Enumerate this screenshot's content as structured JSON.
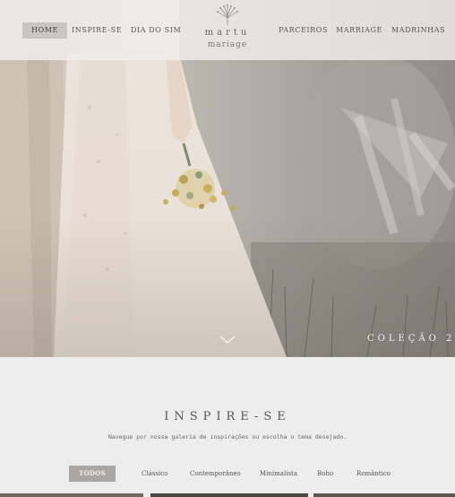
{
  "nav": {
    "left_items": [
      {
        "label": "HOME",
        "active": true
      },
      {
        "label": "INSPIRE-SE",
        "active": false
      },
      {
        "label": "DIA DO SIM",
        "active": false
      }
    ],
    "right_items": [
      {
        "label": "PARCEIROS"
      },
      {
        "label": "MARRIAGE"
      },
      {
        "label": "MADRINHAS"
      }
    ],
    "logo": {
      "name": "martu",
      "subtitle": "mariage",
      "icon": "flower-bouquet-logo-icon"
    }
  },
  "hero": {
    "collection_label": "COLEÇÃO 2",
    "scroll_icon": "chevron-down-icon"
  },
  "inspire": {
    "title": "INSPIRE-SE",
    "subtitle": "Navegue por nossa galeria de inspirações ou escolha o tema desejado.",
    "filters": [
      "TODOS",
      "Clássico",
      "Contemporâneo",
      "Minimalista",
      "Boho",
      "Romântico"
    ],
    "active_filter": "TODOS"
  },
  "colors": {
    "nav_bg": "#f0eeeb",
    "active_nav": "#c9c6c2",
    "active_filter": "#a9a7a4",
    "page_bg": "#ededed"
  }
}
